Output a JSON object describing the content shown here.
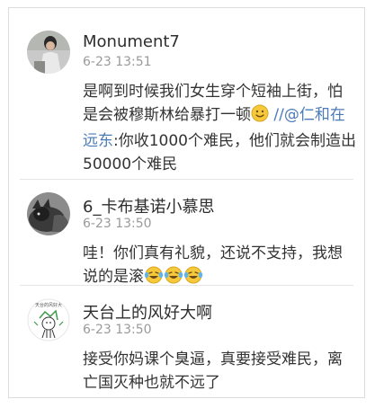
{
  "comments": [
    {
      "username": "Monument7",
      "time": "6-23 13:51",
      "text_before_emoji": "是啊到时候我们女生穿个短袖上街，怕是会被穆斯林给暴打一顿",
      "emoji": "smiling-face-icon",
      "separator": " //",
      "mention": "@仁和在远东",
      "text_after_mention": ":你收1000个难民，他们就会制造出50000个难民"
    },
    {
      "username": "6_卡布基诺小慕思",
      "time": "6-23 13:50",
      "text": "哇！你们真有礼貌，还说不支持，我想说的是滚",
      "emojis": [
        "laughing-crying-icon",
        "laughing-crying-icon",
        "laughing-crying-icon"
      ]
    },
    {
      "username": "天台上的风好大啊",
      "time": "6-23 13:50",
      "avatar_text": "天台的风好大",
      "text": "接受你妈课个臭逼，真要接受难民，离亡国灭种也就不远了"
    }
  ],
  "colors": {
    "link": "#4a7bb7",
    "text": "#333333",
    "meta": "#9a9a9a"
  }
}
